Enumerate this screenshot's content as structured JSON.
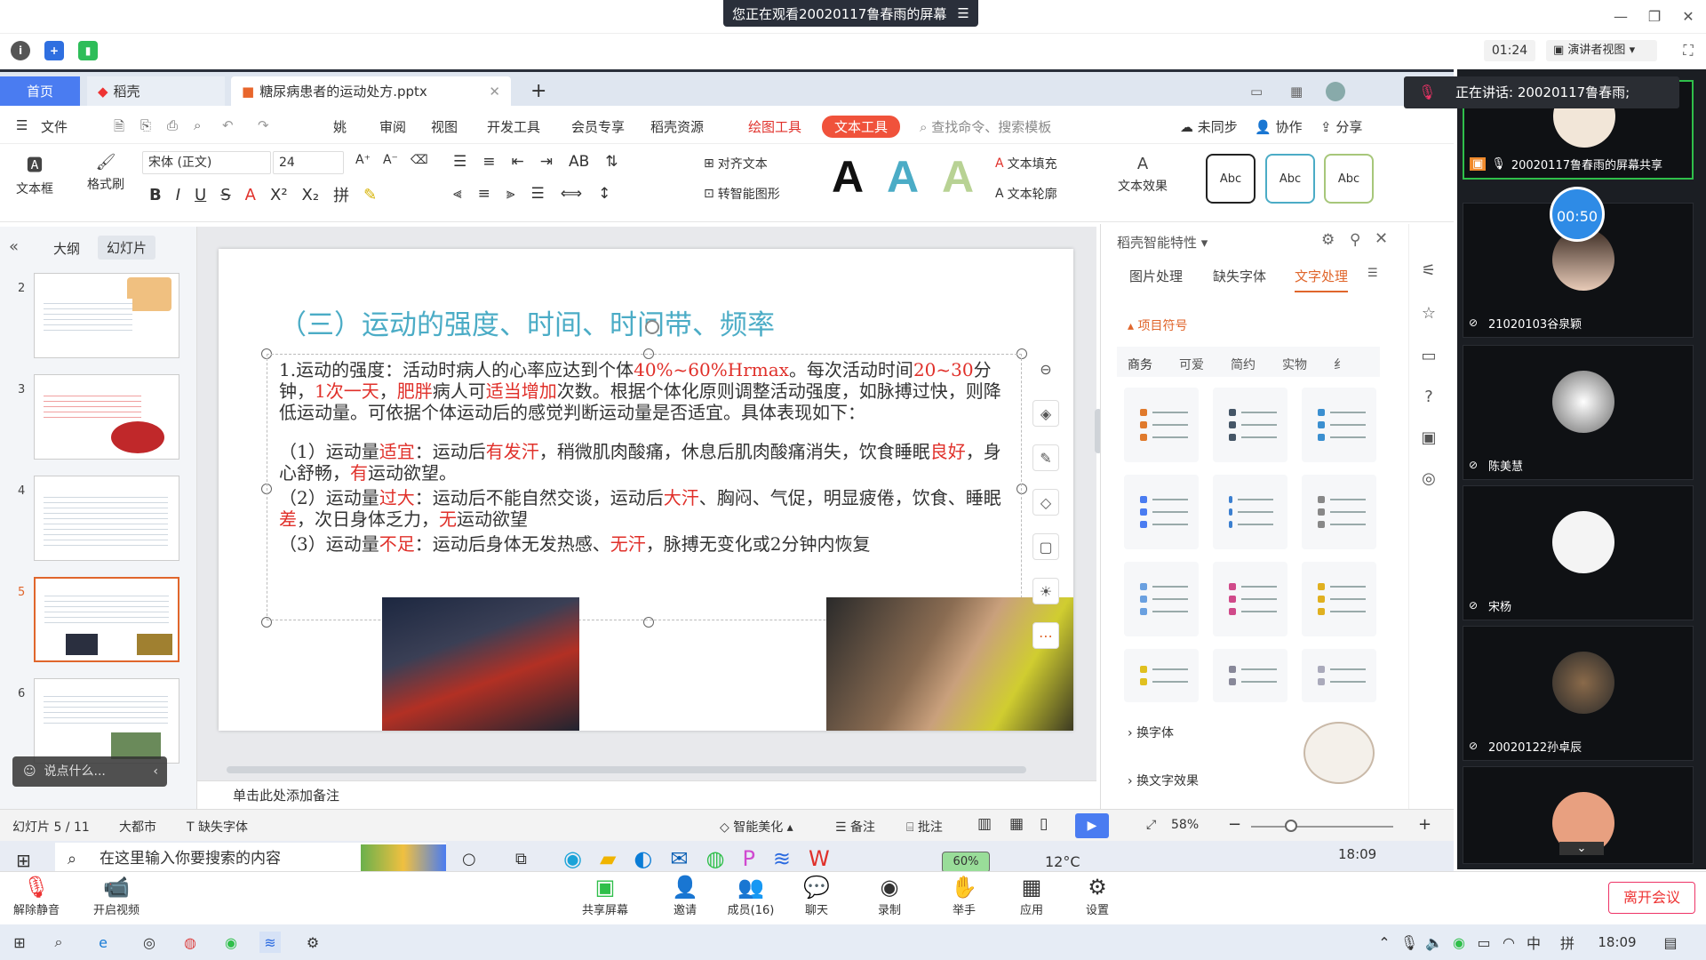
{
  "meeting": {
    "viewing_banner": "您正在观看20020117鲁春雨的屏幕",
    "timer": "01:24",
    "presenter_view": "演讲者视图",
    "speaking": "正在讲话: 20020117鲁春雨;",
    "timer_bubble": "00:50",
    "participants": [
      {
        "name": "20020117鲁春雨的屏幕共享"
      },
      {
        "name": "21020103谷泉颖"
      },
      {
        "name": "陈美慧"
      },
      {
        "name": "宋杨"
      },
      {
        "name": "20020122孙卓辰"
      }
    ],
    "toolbar": {
      "mute": "解除静音",
      "video": "开启视频",
      "share": "共享屏幕",
      "invite": "邀请",
      "members": "成员(16)",
      "chat": "聊天",
      "record": "录制",
      "raise": "举手",
      "apps": "应用",
      "settings": "设置",
      "leave": "离开会议"
    },
    "chat_input": "说点什么..."
  },
  "wps": {
    "tabs": {
      "home": "首页",
      "daoke": "稻壳",
      "file": "糖尿病患者的运动处方.pptx"
    },
    "menu": [
      "文件",
      "姚",
      "审阅",
      "视图",
      "开发工具",
      "会员专享",
      "稻壳资源",
      "绘图工具",
      "文本工具"
    ],
    "search": "查找命令、搜索模板",
    "sync": "未同步",
    "collab": "协作",
    "share": "分享",
    "ribbon": {
      "textbox": "文本框",
      "painter": "格式刷",
      "font": "宋体 (正文)",
      "size": "24",
      "align_text": "对齐文本",
      "smartart": "转智能图形",
      "fill": "文本填充",
      "outline": "文本轮廓",
      "effect": "文本效果",
      "abc": "Abc"
    },
    "left": {
      "outline_tab": "大纲",
      "slides_tab": "幻灯片",
      "slide_nums": [
        "2",
        "3",
        "4",
        "5",
        "6"
      ]
    },
    "slide": {
      "title": "（三）运动的强度、时间、时间带、频率",
      "p1a": "1.运动的强度：活动时病人的心率应达到个体",
      "p1b": "40%~60%Hrmax",
      "p1c": "。每次活动时间",
      "p1d": "20~30",
      "p1e": "分钟，",
      "p1f": "1次一天",
      "p1g": "，",
      "p1h": "肥胖",
      "p1i": "病人可",
      "p1j": "适当增加",
      "p1k": "次数。根据个体化原则调整活动强度，如脉搏过快，则降低运动量。可依据个体运动后的感觉判断运动量是否适宜。具体表现如下：",
      "p2a": "（1）运动量",
      "p2b": "适宜",
      "p2c": "：运动后",
      "p2d": "有发汗",
      "p2e": "，稍微肌肉酸痛，休息后肌肉酸痛消失，饮食睡眠",
      "p2f": "良好",
      "p2g": "，身心舒畅，",
      "p2h": "有",
      "p2i": "运动欲望。",
      "p3a": "（2）运动量",
      "p3b": "过大",
      "p3c": "：运动后不能自然交谈，运动后",
      "p3d": "大汗",
      "p3e": "、胸闷、气促，明显疲倦，饮食、睡眠",
      "p3f": "差",
      "p3g": "，次日身体乏力，",
      "p3h": "无",
      "p3i": "运动欲望",
      "p4a": "（3）运动量",
      "p4b": "不足",
      "p4c": "：运动后身体无发热感、",
      "p4d": "无汗",
      "p4e": "，脉搏无变化或2分钟内恢复"
    },
    "notes": "单击此处添加备注",
    "pane": {
      "title": "稻壳智能特性",
      "tabs": [
        "图片处理",
        "缺失字体",
        "文字处理"
      ],
      "section": "项目符号",
      "subtabs": [
        "商务",
        "可爱",
        "简约",
        "实物",
        "纟"
      ],
      "swap_font": "换字体",
      "swap_effect": "换文字效果"
    },
    "status": {
      "slide": "幻灯片 5 / 11",
      "theme": "大都市",
      "missing_font": "缺失字体",
      "beautify": "智能美化",
      "notes": "备注",
      "comment": "批注",
      "zoom": "58%"
    },
    "inner_taskbar": {
      "search": "在这里输入你要搜索的内容",
      "temp": "12°C",
      "time": "18:09",
      "battery": "60%"
    }
  },
  "outer_taskbar": {
    "time": "18:09",
    "ime": "中",
    "layout": "拼"
  },
  "colors": {
    "accent_blue": "#4a7cf1",
    "title_teal": "#4bacc6",
    "red": "#e0302a",
    "text_tool_tab": "#f0523b"
  }
}
